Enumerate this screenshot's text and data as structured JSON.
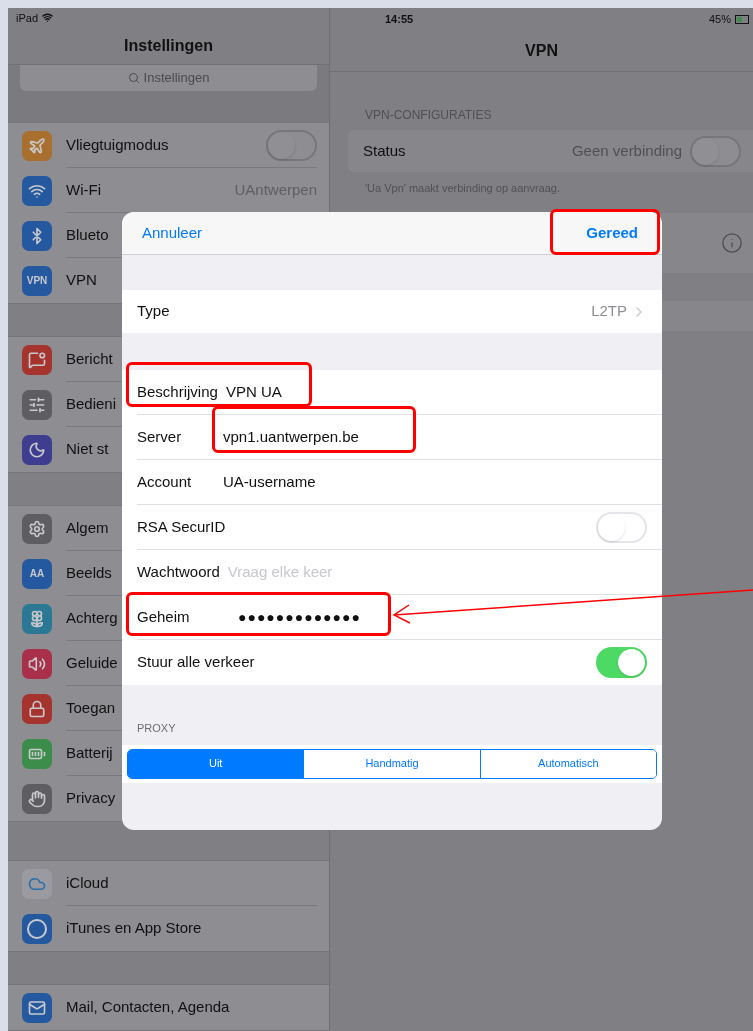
{
  "status_bar": {
    "device": "iPad",
    "time": "14:55",
    "battery": "45%"
  },
  "sidebar": {
    "title": "Instellingen",
    "search": {
      "placeholder": "Instellingen"
    },
    "groups": [
      [
        {
          "kind": "toggle",
          "label": "Vliegtuigmodus",
          "on": false
        },
        {
          "kind": "value",
          "label": "Wi-Fi",
          "value": "UAntwerpen"
        },
        {
          "kind": "plain",
          "label": "Blueto"
        },
        {
          "kind": "plain",
          "label": "VPN",
          "icon_text": "VPN"
        }
      ],
      [
        {
          "kind": "plain",
          "label": "Bericht"
        },
        {
          "kind": "plain",
          "label": "Bedieni"
        },
        {
          "kind": "plain",
          "label": "Niet st"
        }
      ],
      [
        {
          "kind": "plain",
          "label": "Algem"
        },
        {
          "kind": "plain",
          "label": "Beelds",
          "icon_text": "AA"
        },
        {
          "kind": "plain",
          "label": "Achterg"
        },
        {
          "kind": "plain",
          "label": "Geluide"
        },
        {
          "kind": "plain",
          "label": "Toegan"
        },
        {
          "kind": "plain",
          "label": "Batterij"
        },
        {
          "kind": "plain",
          "label": "Privacy"
        }
      ],
      [
        {
          "kind": "plain",
          "label": "iCloud"
        },
        {
          "kind": "plain",
          "label": "iTunes en App Store"
        }
      ],
      [
        {
          "kind": "plain",
          "label": "Mail, Contacten, Agenda"
        }
      ]
    ]
  },
  "detail": {
    "title": "VPN",
    "section_header": "VPN-CONFIGURATIES",
    "status": {
      "label": "Status",
      "value": "Geen verbinding",
      "on": false
    },
    "footnote": "'Ua Vpn' maakt verbinding op aanvraag."
  },
  "dialog": {
    "cancel": "Annuleer",
    "done": "Gereed",
    "type": {
      "label": "Type",
      "value": "L2TP"
    },
    "fields": [
      {
        "kind": "text",
        "label": "Beschrijving",
        "value": "VPN UA"
      },
      {
        "kind": "text",
        "label": "Server",
        "value": "vpn1.uantwerpen.be"
      },
      {
        "kind": "text",
        "label": "Account",
        "value": "UA-username"
      },
      {
        "kind": "toggle",
        "label": "RSA SecurID",
        "on": false
      },
      {
        "kind": "text",
        "label": "Wachtwoord",
        "placeholder": "Vraag elke keer"
      },
      {
        "kind": "secret",
        "label": "Geheim",
        "value": "●●●●●●●●●●●●●"
      },
      {
        "kind": "toggle",
        "label": "Stuur alle verkeer",
        "on": true
      }
    ],
    "proxy": {
      "header": "PROXY",
      "options": [
        {
          "label": "Uit",
          "selected": true
        },
        {
          "label": "Handmatig",
          "selected": false
        },
        {
          "label": "Automatisch",
          "selected": false
        }
      ]
    }
  }
}
